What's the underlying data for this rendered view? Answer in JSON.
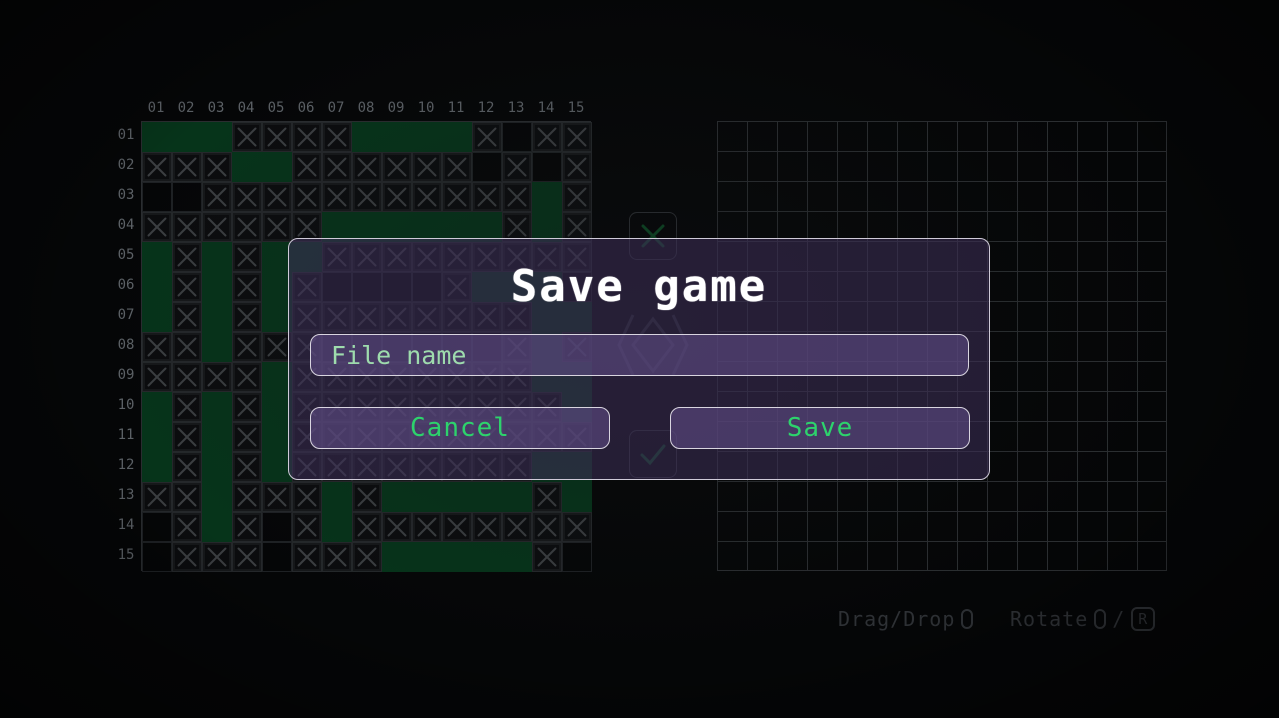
{
  "board": {
    "column_numbers": [
      "01",
      "02",
      "03",
      "04",
      "05",
      "06",
      "07",
      "08",
      "09",
      "10",
      "11",
      "12",
      "13",
      "14",
      "15"
    ],
    "row_numbers": [
      "01",
      "02",
      "03",
      "04",
      "05",
      "06",
      "07",
      "08",
      "09",
      "10",
      "11",
      "12",
      "13",
      "14",
      "15"
    ],
    "grid": [
      "fffxxxxffffxexx",
      "xxxffxxxxxxexex",
      "eexxxxxxxxxxxfx",
      "xxxxxxffffffxfx",
      "fxfxffxxxxxxxxx",
      "fxfxfxeeeexfffe",
      "fxfxfxxxxxxxxff",
      "xxfxxxeeeeeexfx",
      "xxxxfxxxxxxxxff",
      "fxfxfxxxxxxxxxf",
      "fxfxfxxxxxxxxxx",
      "fxfxfxxxxxxxxff",
      "xxfxxxfxfffffxf",
      "exfxexfxxxxxxxx",
      "exxxexxxfffffxe"
    ]
  },
  "controls": {
    "confirm_icon": "check-icon",
    "reject_icon": "cross-icon",
    "center_icon": "diamond-icon"
  },
  "hints": {
    "drag_drop": "Drag/Drop",
    "rotate": "Rotate",
    "separator": "/",
    "rotate_key": "R"
  },
  "modal": {
    "title": "Save game",
    "file_name_placeholder": "File name",
    "file_name_value": "",
    "cancel_label": "Cancel",
    "save_label": "Save"
  },
  "colors": {
    "filled": "#06341a",
    "accent_green": "#2dd36c",
    "modal_bg": "#3e305a",
    "background": "#050607"
  }
}
